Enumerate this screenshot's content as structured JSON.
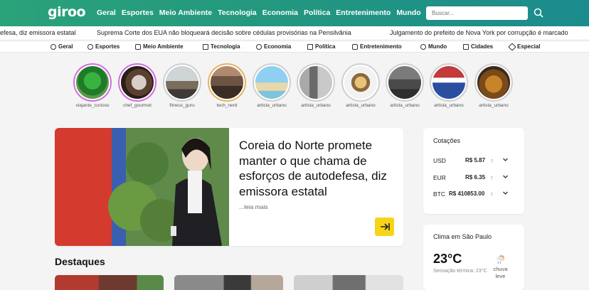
{
  "header": {
    "logo": "giroo",
    "nav": [
      "Geral",
      "Esportes",
      "Meio Ambiente",
      "Tecnologia",
      "Economia",
      "Política",
      "Entretenimento",
      "Mundo"
    ],
    "search_placeholder": "Buscar..."
  },
  "ticker": [
    "efesa, diz emissora estatal",
    "Suprema Corte dos EUA não bloqueará decisão sobre cédulas provisórias na Pensilvânia",
    "Julgamento do prefeito de Nova York por corrupção é marcado"
  ],
  "categories": [
    {
      "label": "Geral",
      "icon": "globe-icon"
    },
    {
      "label": "Esportes",
      "icon": "ball-icon"
    },
    {
      "label": "Meio Ambiente",
      "icon": "leaf-icon"
    },
    {
      "label": "Tecnologia",
      "icon": "chip-icon"
    },
    {
      "label": "Economia",
      "icon": "coins-icon"
    },
    {
      "label": "Política",
      "icon": "megaphone-icon"
    },
    {
      "label": "Entretenimento",
      "icon": "ticket-icon"
    },
    {
      "label": "Mundo",
      "icon": "globe-icon"
    },
    {
      "label": "Cidades",
      "icon": "buildings-icon"
    },
    {
      "label": "Especial",
      "icon": "diamond-icon"
    }
  ],
  "stories": [
    {
      "user": "viajante_curioso",
      "seen": false
    },
    {
      "user": "chef_gourmet",
      "seen": false
    },
    {
      "user": "fitness_guru",
      "seen": true
    },
    {
      "user": "tech_nerd",
      "seen": false
    },
    {
      "user": "artista_urbano",
      "seen": true
    },
    {
      "user": "artista_urbano",
      "seen": true
    },
    {
      "user": "artista_urbano",
      "seen": true
    },
    {
      "user": "artista_urbano",
      "seen": true
    },
    {
      "user": "artista_urbano",
      "seen": true
    },
    {
      "user": "artista_urbano",
      "seen": true
    }
  ],
  "hero": {
    "title": "Coreia do Norte promete manter o que chama de esforços de autodefesa, diz emissora estatal",
    "more": "...leia mais"
  },
  "cotacoes": {
    "title": "Cotações",
    "rows": [
      {
        "currency": "USD",
        "value": "R$ 5.87"
      },
      {
        "currency": "EUR",
        "value": "R$ 6.35"
      },
      {
        "currency": "BTC",
        "value": "R$ 410853.00"
      }
    ]
  },
  "clima": {
    "title": "Clima em São Paulo",
    "temp": "23°C",
    "sensacao": "Sensação térmica: 23°C",
    "condition": "chuva leve"
  },
  "destaques_title": "Destaques",
  "colors": {
    "brand_green": "#2aa27a",
    "accent_yellow": "#f7d417",
    "unseen_ring": "#d46be0",
    "seen_ring": "#cfcfcf"
  }
}
